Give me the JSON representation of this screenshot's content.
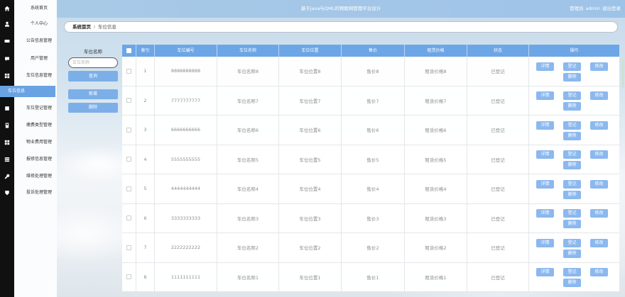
{
  "app": {
    "title": "基于java与QML的物联网管理平台设计"
  },
  "header": {
    "role": "管理员",
    "username": "admin",
    "logout_label": "退出登录"
  },
  "sidebar": {
    "items": [
      {
        "label": "系统首页",
        "icon": "home-icon"
      },
      {
        "label": "个人中心",
        "icon": "user-icon"
      },
      {
        "label": "公告信息管理",
        "icon": "card-icon"
      },
      {
        "label": "用户管理",
        "icon": "comment-icon"
      },
      {
        "label": "车位信息管理",
        "icon": "grid-icon",
        "children": [
          {
            "label": "车位信息",
            "active": true
          }
        ]
      },
      {
        "label": "车位登记管理",
        "icon": "square-icon"
      },
      {
        "label": "缴费类型管理",
        "icon": "document-icon"
      },
      {
        "label": "物业费用管理",
        "icon": "grid-icon"
      },
      {
        "label": "报修信息管理",
        "icon": "list-icon"
      },
      {
        "label": "维修处理管理",
        "icon": "wrench-icon"
      },
      {
        "label": "投诉处理管理",
        "icon": "shield-icon"
      }
    ]
  },
  "breadcrumb": {
    "home": "系统首页",
    "separator": "Ⅰ",
    "current": "车位信息"
  },
  "search": {
    "label": "车位名称",
    "placeholder": "车位名称",
    "query_label": "查询",
    "add_label": "新增",
    "delete_label": "删除"
  },
  "table": {
    "headers": [
      "索引",
      "车位编号",
      "车位名称",
      "车位位置",
      "售价",
      "租赁价格",
      "状态",
      "操作"
    ],
    "actions": {
      "detail": "详情",
      "register": "登记",
      "edit": "修改",
      "delete": "删除"
    },
    "rows": [
      {
        "index": "1",
        "code": "8888888888",
        "name": "车位名称8",
        "location": "车位位置8",
        "price": "售价8",
        "rent": "租赁价格8",
        "status": "已登记"
      },
      {
        "index": "2",
        "code": "7777777777",
        "name": "车位名称7",
        "location": "车位位置7",
        "price": "售价7",
        "rent": "租赁价格7",
        "status": "已登记"
      },
      {
        "index": "3",
        "code": "6666666666",
        "name": "车位名称6",
        "location": "车位位置6",
        "price": "售价6",
        "rent": "租赁价格6",
        "status": "已登记"
      },
      {
        "index": "4",
        "code": "5555555555",
        "name": "车位名称5",
        "location": "车位位置5",
        "price": "售价5",
        "rent": "租赁价格5",
        "status": "已登记"
      },
      {
        "index": "5",
        "code": "4444444444",
        "name": "车位名称4",
        "location": "车位位置4",
        "price": "售价4",
        "rent": "租赁价格4",
        "status": "已登记"
      },
      {
        "index": "6",
        "code": "3333333333",
        "name": "车位名称3",
        "location": "车位位置3",
        "price": "售价3",
        "rent": "租赁价格3",
        "status": "已登记"
      },
      {
        "index": "7",
        "code": "2222222222",
        "name": "车位名称2",
        "location": "车位位置2",
        "price": "售价2",
        "rent": "租赁价格2",
        "status": "已登记"
      },
      {
        "index": "8",
        "code": "1111111111",
        "name": "车位名称1",
        "location": "车位位置1",
        "price": "售价1",
        "rent": "租赁价格1",
        "status": "已登记"
      }
    ]
  },
  "colors": {
    "sidebar_strip": "#101010",
    "accent": "#6ca6e6",
    "active_menu": "#6aa3e3",
    "action_button": "#8bb8ee",
    "side_button": "#7cafe8",
    "topbar": "#9ec3e8"
  }
}
